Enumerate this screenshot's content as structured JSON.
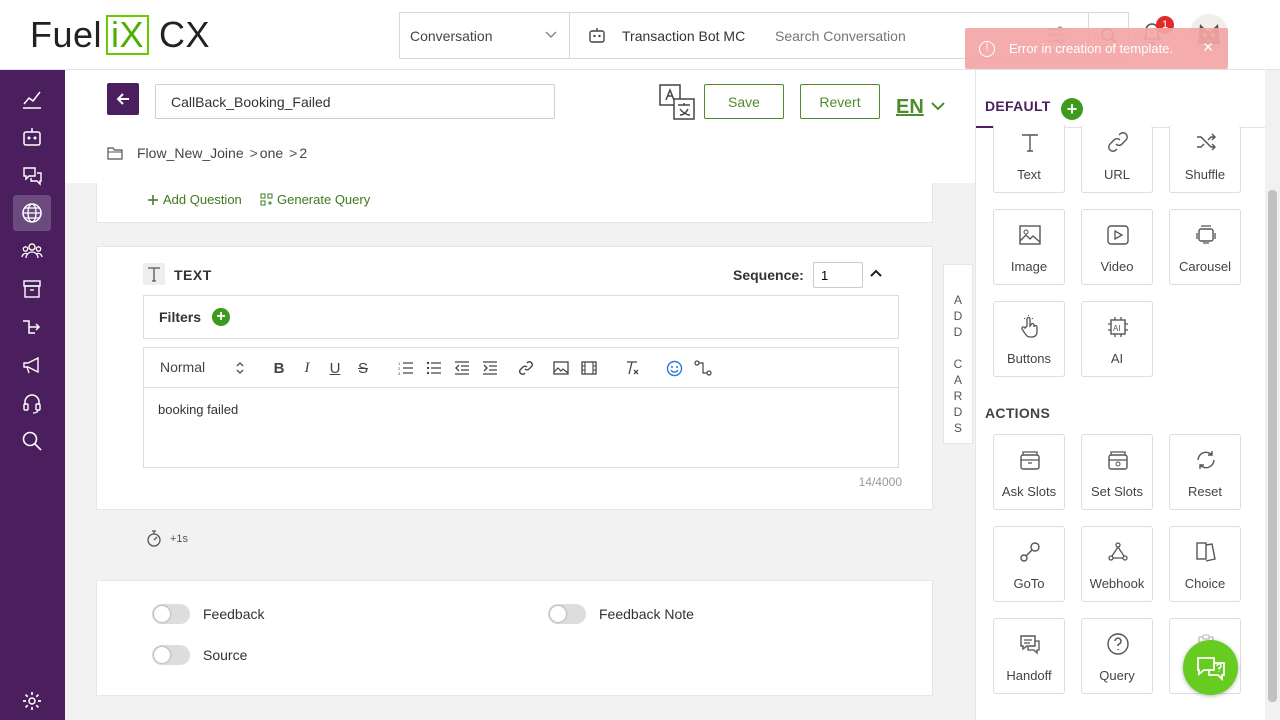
{
  "header": {
    "logo": {
      "part1": "Fuel",
      "part2": "iX",
      "part3": "CX"
    },
    "search_type": "Conversation",
    "bot_name": "Transaction Bot MC",
    "search_placeholder": "Search Conversation",
    "notification_count": "1"
  },
  "toast": {
    "message": "Error in creation of template.",
    "close": "✕"
  },
  "sidebar": {
    "items": [
      {
        "icon": "analytics-icon"
      },
      {
        "icon": "bot-icon"
      },
      {
        "icon": "faq-icon"
      },
      {
        "icon": "globe-icon",
        "active": true
      },
      {
        "icon": "users-icon"
      },
      {
        "icon": "archive-icon"
      },
      {
        "icon": "flow-icon"
      },
      {
        "icon": "megaphone-icon"
      },
      {
        "icon": "headset-icon"
      },
      {
        "icon": "search-icon"
      },
      {
        "icon": "settings-icon"
      }
    ]
  },
  "editor": {
    "template_name": "CallBack_Booking_Failed",
    "save_label": "Save",
    "revert_label": "Revert",
    "language": "EN",
    "breadcrumb": {
      "folder": "Flow_New_Joine",
      "level1": "one",
      "level2": "2",
      "sep": ">"
    }
  },
  "question_card": {
    "add_question": "Add Question",
    "generate_query": "Generate Query"
  },
  "text_card": {
    "type_label": "TEXT",
    "sequence_label": "Sequence:",
    "sequence_value": "1",
    "filters_label": "Filters",
    "toolbar_format": "Normal",
    "body": "booking failed",
    "char_count": "14/4000"
  },
  "add_cards": [
    "A",
    "D",
    "D",
    "",
    "C",
    "A",
    "R",
    "D",
    "S"
  ],
  "delay": "+1s",
  "toggles": {
    "feedback": "Feedback",
    "feedback_note": "Feedback Note",
    "source": "Source"
  },
  "right_panel": {
    "tab": "DEFAULT",
    "cards": [
      {
        "label": "Text",
        "icon": "text-icon"
      },
      {
        "label": "URL",
        "icon": "link-icon"
      },
      {
        "label": "Shuffle",
        "icon": "shuffle-icon"
      },
      {
        "label": "Image",
        "icon": "image-icon"
      },
      {
        "label": "Video",
        "icon": "video-icon"
      },
      {
        "label": "Carousel",
        "icon": "carousel-icon"
      },
      {
        "label": "Buttons",
        "icon": "pointer-icon"
      },
      {
        "label": "AI",
        "icon": "ai-chip-icon"
      }
    ],
    "actions_label": "ACTIONS",
    "actions": [
      {
        "label": "Ask Slots",
        "icon": "slot-icon"
      },
      {
        "label": "Set Slots",
        "icon": "set-slot-icon"
      },
      {
        "label": "Reset",
        "icon": "reset-icon"
      },
      {
        "label": "GoTo",
        "icon": "goto-icon"
      },
      {
        "label": "Webhook",
        "icon": "webhook-icon"
      },
      {
        "label": "Choice",
        "icon": "choice-icon"
      },
      {
        "label": "Handoff",
        "icon": "handoff-icon"
      },
      {
        "label": "Query",
        "icon": "question-icon"
      }
    ]
  },
  "colors": {
    "brand_purple": "#4b1e5d",
    "accent_green": "#4c8c2b",
    "toast_bg": "#f4a6a6",
    "badge_red": "#e0292b",
    "fab_green": "#66cc22"
  }
}
